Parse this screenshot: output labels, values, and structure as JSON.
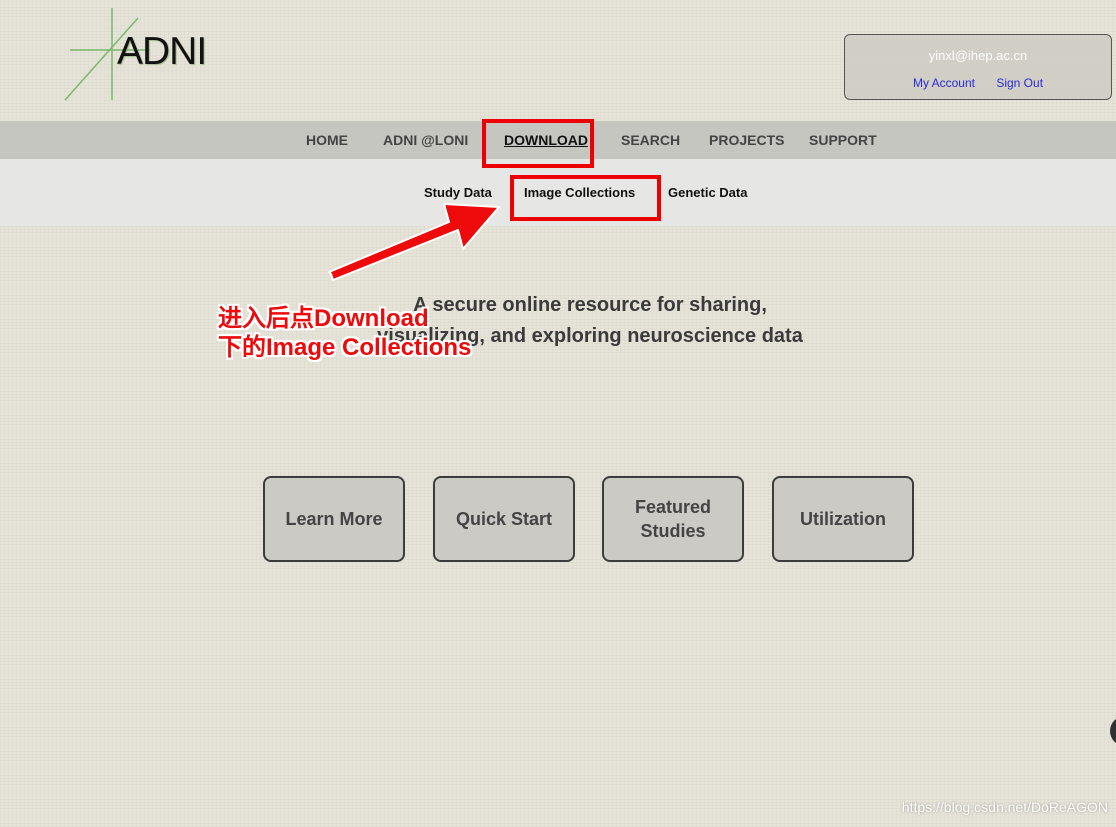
{
  "logo": {
    "text": "ADNI"
  },
  "account": {
    "email": "yinxl@ihep.ac.cn",
    "my_account": "My Account",
    "sign_out": "Sign Out"
  },
  "nav": {
    "items": [
      {
        "label": "HOME"
      },
      {
        "label": "ADNI @LONI"
      },
      {
        "label": "DOWNLOAD",
        "active": true
      },
      {
        "label": "SEARCH"
      },
      {
        "label": "PROJECTS"
      },
      {
        "label": "SUPPORT"
      }
    ]
  },
  "subnav": {
    "items": [
      {
        "label": "Study Data"
      },
      {
        "label": "Image Collections"
      },
      {
        "label": "Genetic Data"
      }
    ]
  },
  "hero": {
    "line1": "A secure online resource for sharing,",
    "line2": "visualizing, and exploring neuroscience data"
  },
  "annotation": {
    "line1": "进入后点Download",
    "line2": "下的Image Collections",
    "color": "#ee0a0a"
  },
  "tiles": [
    {
      "label": "Learn More"
    },
    {
      "label": "Quick Start"
    },
    {
      "label_line1": "Featured",
      "label_line2": "Studies"
    },
    {
      "label": "Utilization"
    }
  ],
  "watermark": "https://blog.csdn.net/DoReAGON",
  "colors": {
    "highlight": "#ee0000",
    "nav_bar": "#c6c6c0",
    "sub_nav_bar": "#e6e6e4",
    "link": "#2a2ad6"
  }
}
